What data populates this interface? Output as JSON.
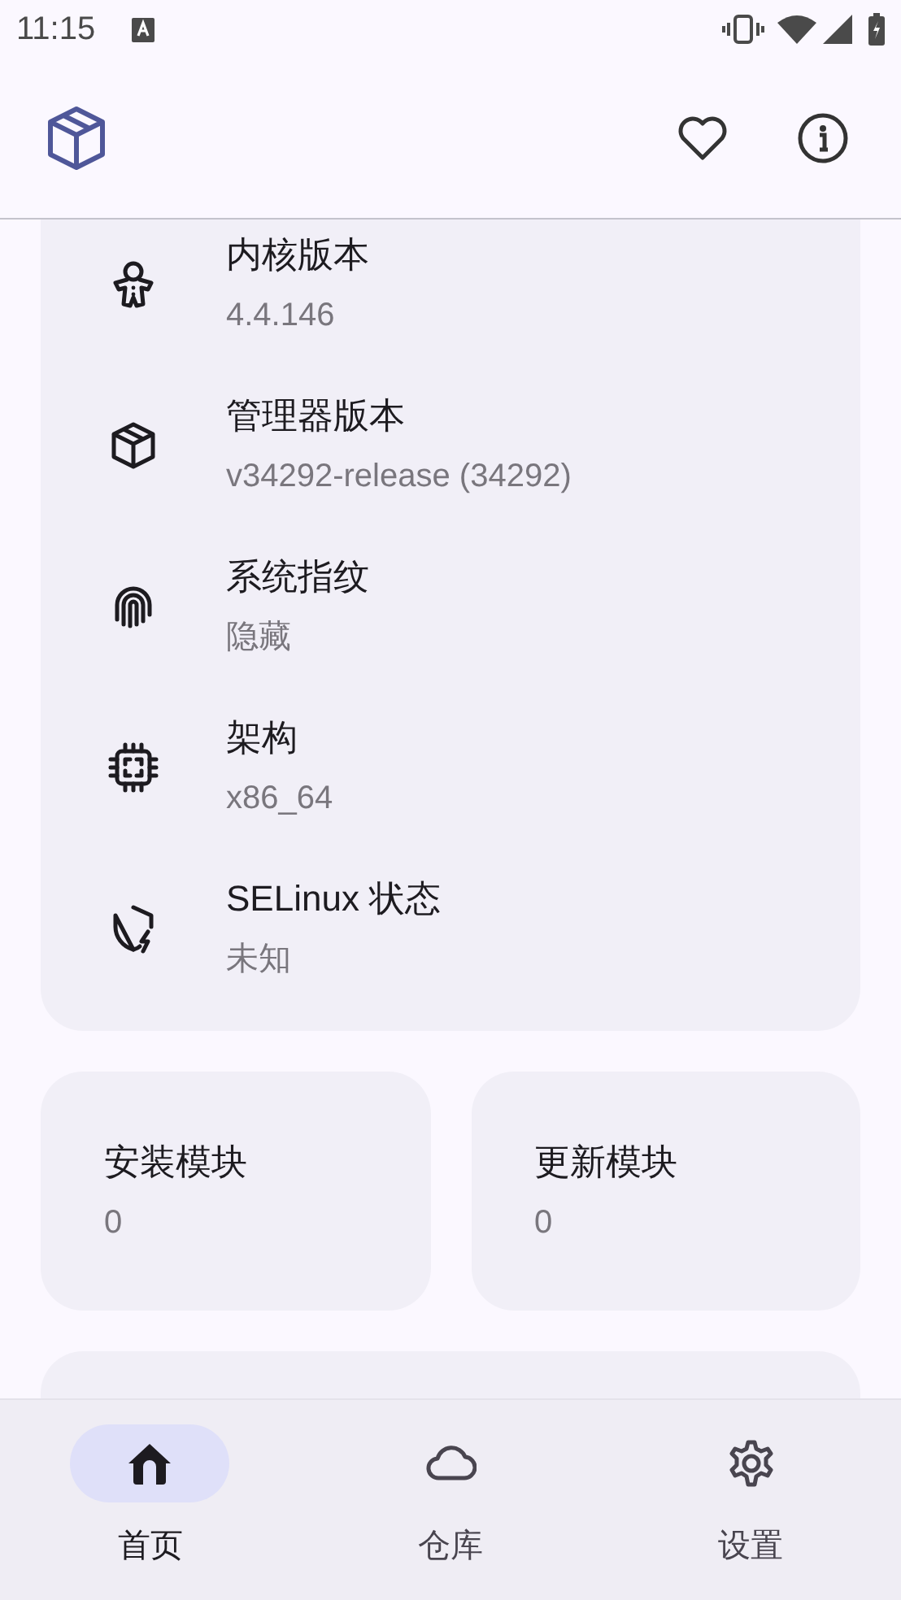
{
  "status_bar": {
    "time": "11:15"
  },
  "info_items": [
    {
      "title": "内核版本",
      "value": "4.4.146"
    },
    {
      "title": "管理器版本",
      "value": "v34292-release (34292)"
    },
    {
      "title": "系统指纹",
      "value": "隐藏"
    },
    {
      "title": "架构",
      "value": "x86_64"
    },
    {
      "title": "SELinux 状态",
      "value": "未知"
    }
  ],
  "module_stats": [
    {
      "label": "安装模块",
      "value": "0"
    },
    {
      "label": "更新模块",
      "value": "0"
    }
  ],
  "bottom_nav": [
    {
      "label": "首页",
      "selected": true
    },
    {
      "label": "仓库",
      "selected": false
    },
    {
      "label": "设置",
      "selected": false
    }
  ]
}
